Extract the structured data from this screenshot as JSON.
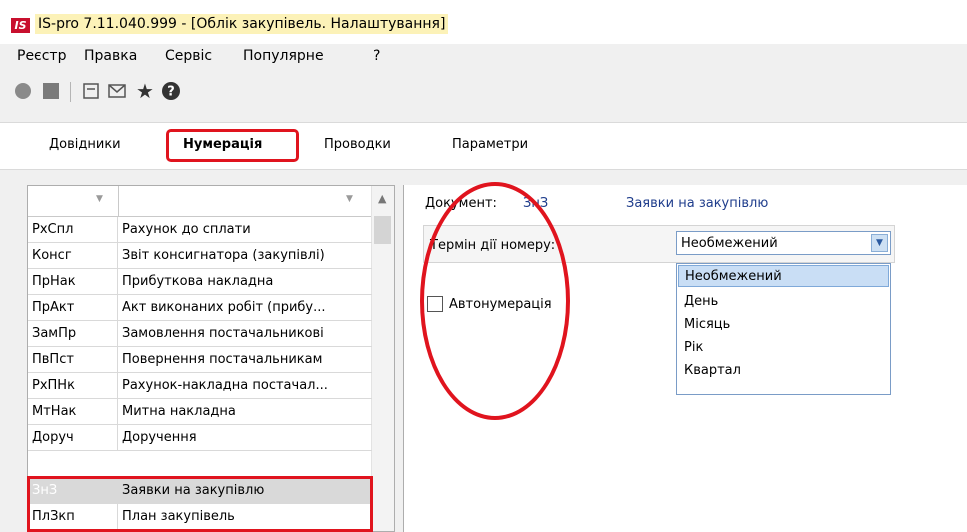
{
  "window": {
    "logo_text": "IS",
    "title": "IS-pro 7.11.040.999 - [Облік закупівель. Налаштування]"
  },
  "menu": [
    "Реєстр",
    "Правка",
    "Сервіс",
    "Популярне",
    "?"
  ],
  "toolbar": {
    "icons": [
      "record-icon",
      "stop-icon",
      "window-icon",
      "mail-icon",
      "star-icon",
      "help-icon"
    ],
    "star_glyph": "★",
    "help_glyph": "?"
  },
  "tabs": [
    {
      "label": "Довідники",
      "active": false
    },
    {
      "label": "Нумерація",
      "active": true
    },
    {
      "label": "Проводки",
      "active": false
    },
    {
      "label": "Параметри",
      "active": false
    }
  ],
  "list": {
    "header_arrows": [
      "▼",
      "▼"
    ],
    "scroll_up": "▲",
    "rows": [
      {
        "code": "РхСпл",
        "name": "Рахунок до сплати"
      },
      {
        "code": "Консг",
        "name": "Звіт консигнатора (закупівлі)"
      },
      {
        "code": "ПрНак",
        "name": "Прибуткова накладна"
      },
      {
        "code": "ПрАкт",
        "name": "Акт виконаних робіт (прибу..."
      },
      {
        "code": "ЗамПр",
        "name": "Замовлення постачальникові"
      },
      {
        "code": "ПвПст",
        "name": "Повернення постачальникам"
      },
      {
        "code": "РхПНк",
        "name": "Рахунок-накладна постачал..."
      },
      {
        "code": "МтНак",
        "name": "Митна накладна"
      },
      {
        "code": "Доруч",
        "name": "Доручення"
      },
      {
        "code": "ЗнЗ",
        "name": "Заявки на закупівлю",
        "selected": true
      },
      {
        "code": "ПлЗкп",
        "name": "План закупівель"
      }
    ]
  },
  "detail": {
    "document_label": "Документ:",
    "document_code": "ЗнЗ",
    "document_name": "Заявки на закупівлю",
    "term_label": "Термін дії номеру:",
    "term_value": "Необмежений",
    "combo_arrow": "▼",
    "term_options": [
      "Необмежений",
      "День",
      "Місяць",
      "Рік",
      "Квартал"
    ],
    "autonumbering_label": "Автонумерація",
    "autonumbering_checked": false
  },
  "colors": {
    "highlight_red": "#e0141e",
    "link_blue": "#1f3d8c",
    "selection_blue": "#c9def5"
  }
}
